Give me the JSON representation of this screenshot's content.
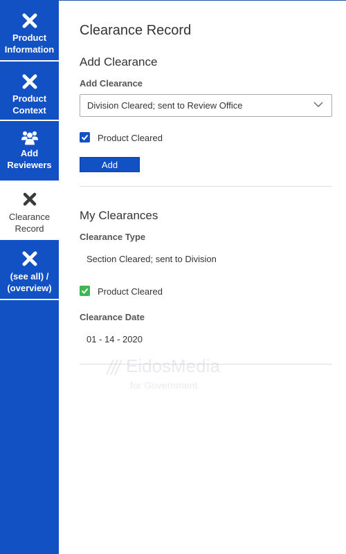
{
  "sidebar": {
    "items": [
      {
        "icon": "close-icon",
        "line1": "Product",
        "line2": "Information",
        "active": false
      },
      {
        "icon": "close-icon",
        "line1": "Product",
        "line2": "Context",
        "active": false
      },
      {
        "icon": "users-icon",
        "line1": "Add",
        "line2": "Reviewers",
        "active": false
      },
      {
        "icon": "close-icon",
        "line1": "Clearance",
        "line2": "Record",
        "active": true
      },
      {
        "icon": "close-icon",
        "line1": "(see all) /",
        "line2": "(overview)",
        "active": false
      }
    ]
  },
  "main": {
    "title": "Clearance Record",
    "add_section": {
      "heading": "Add Clearance",
      "field_label": "Add Clearance",
      "select_value": "Division Cleared; sent to Review Office",
      "checkbox_label": "Product Cleared",
      "checkbox_checked": true,
      "button_label": "Add"
    },
    "my_section": {
      "heading": "My Clearances",
      "type_label": "Clearance Type",
      "type_value": "Section Cleared; sent to Division",
      "checkbox_label": "Product Cleared",
      "checkbox_checked": true,
      "date_label": "Clearance Date",
      "date_value": "01 - 14 - 2020"
    },
    "watermark": {
      "line1": "EidosMedia",
      "line2": "for Government"
    }
  },
  "colors": {
    "sidebar_blue": "#1151c3",
    "checkbox_blue": "#1151c3",
    "checkbox_green": "#3db653"
  }
}
